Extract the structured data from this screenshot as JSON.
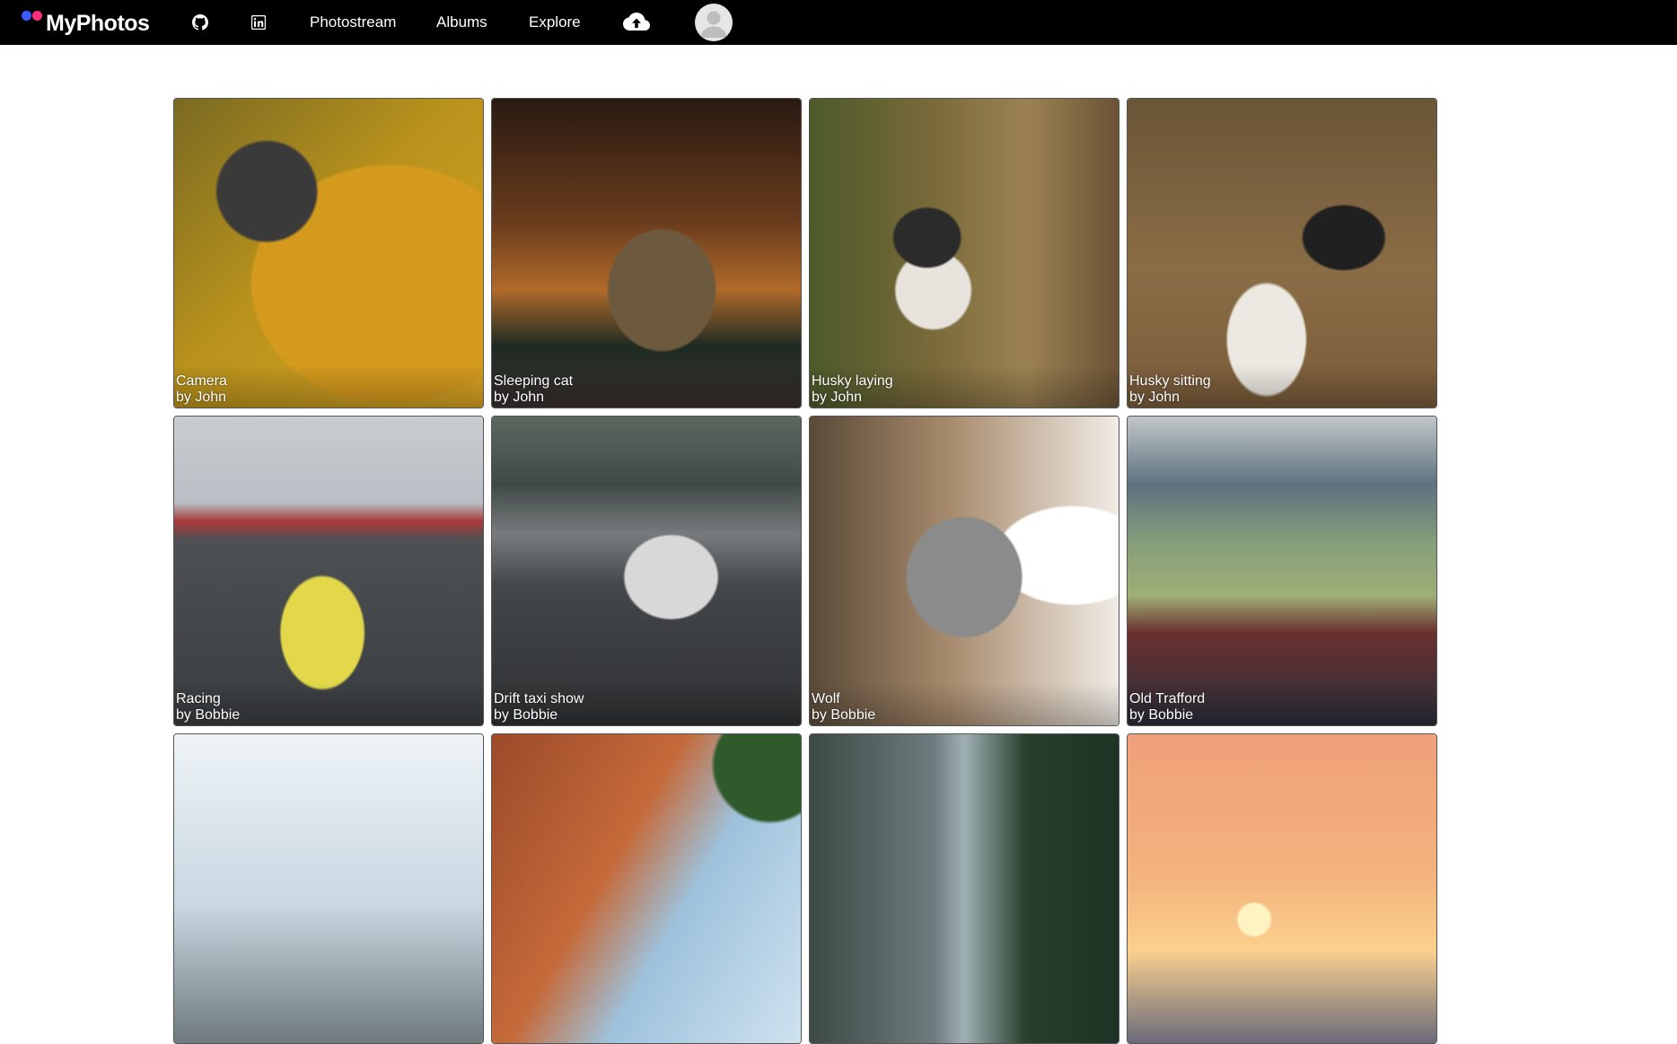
{
  "navbar": {
    "brand": "MyPhotos",
    "icons": {
      "github": "github-icon",
      "linkedin": "linkedin-icon",
      "upload": "cloud-upload-icon",
      "avatar": "user-avatar-icon"
    },
    "links": [
      "Photostream",
      "Albums",
      "Explore"
    ]
  },
  "colors": {
    "navbar_bg": "#000000",
    "brand_dot_blue": "#3d5afe",
    "brand_dot_pink": "#ff2d7a",
    "page_bg": "#ffffff"
  },
  "photos": [
    {
      "title": "Camera",
      "author": "by John"
    },
    {
      "title": "Sleeping cat",
      "author": "by John"
    },
    {
      "title": "Husky laying",
      "author": "by John"
    },
    {
      "title": "Husky sitting",
      "author": "by John"
    },
    {
      "title": "Racing",
      "author": "by Bobbie"
    },
    {
      "title": "Drift taxi show",
      "author": "by Bobbie"
    },
    {
      "title": "Wolf",
      "author": "by Bobbie"
    },
    {
      "title": "Old Trafford",
      "author": "by Bobbie"
    },
    {
      "title": "",
      "author": ""
    },
    {
      "title": "",
      "author": ""
    },
    {
      "title": "",
      "author": ""
    },
    {
      "title": "",
      "author": ""
    }
  ]
}
